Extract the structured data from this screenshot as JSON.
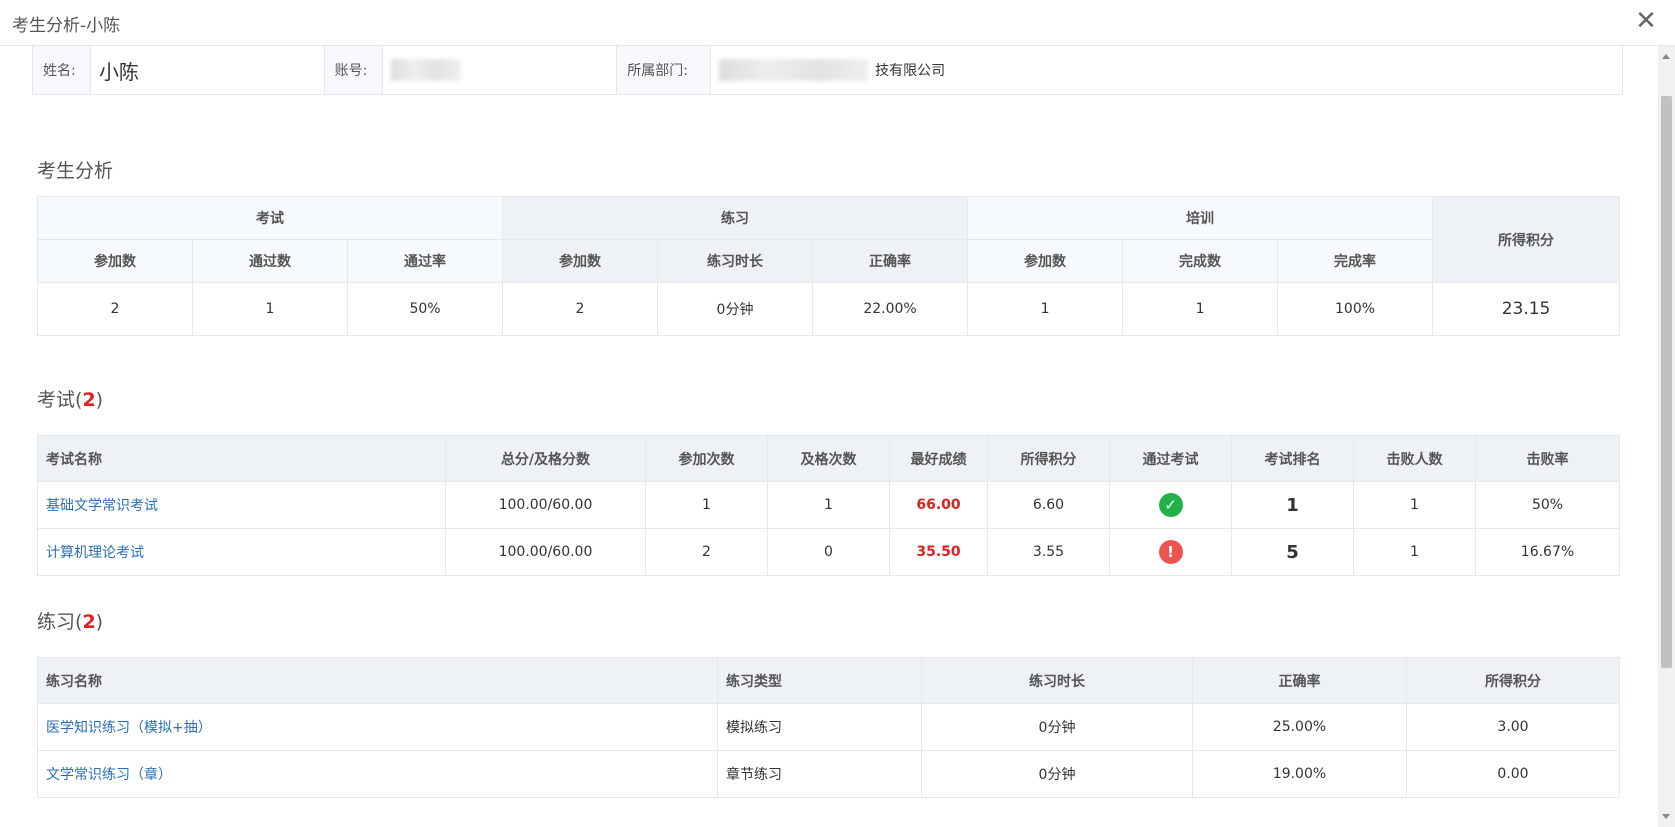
{
  "window": {
    "title": "考生分析-小陈",
    "close_label": "✕"
  },
  "info": {
    "name_label": "姓名:",
    "name_value": "小陈",
    "account_label": "账号:",
    "dept_label": "所属部门:",
    "dept_value": "技有限公司"
  },
  "analysis": {
    "title": "考生分析",
    "groups": {
      "exam": "考试",
      "practice": "练习",
      "training": "培训",
      "points": "所得积分"
    },
    "sub": {
      "exam_join": "参加数",
      "exam_pass": "通过数",
      "exam_rate": "通过率",
      "prac_join": "参加数",
      "prac_time": "练习时长",
      "prac_acc": "正确率",
      "train_join": "参加数",
      "train_done": "完成数",
      "train_rate": "完成率"
    },
    "values": {
      "exam_join": "2",
      "exam_pass": "1",
      "exam_rate": "50%",
      "prac_join": "2",
      "prac_time": "0分钟",
      "prac_acc": "22.00%",
      "train_join": "1",
      "train_done": "1",
      "train_rate": "100%",
      "points": "23.15"
    }
  },
  "exams": {
    "title": "考试",
    "count": "2",
    "headers": [
      "考试名称",
      "总分/及格分数",
      "参加次数",
      "及格次数",
      "最好成绩",
      "所得积分",
      "通过考试",
      "考试排名",
      "击败人数",
      "击败率"
    ],
    "rows": [
      {
        "name": "基础文学常识考试",
        "score": "100.00/60.00",
        "attempts": "1",
        "passes": "1",
        "best": "66.00",
        "points": "6.60",
        "passed": true,
        "rank": "1",
        "defeated": "1",
        "rate": "50%"
      },
      {
        "name": "计算机理论考试",
        "score": "100.00/60.00",
        "attempts": "2",
        "passes": "0",
        "best": "35.50",
        "points": "3.55",
        "passed": false,
        "rank": "5",
        "defeated": "1",
        "rate": "16.67%"
      }
    ]
  },
  "practices": {
    "title": "练习",
    "count": "2",
    "headers": [
      "练习名称",
      "练习类型",
      "练习时长",
      "正确率",
      "所得积分"
    ],
    "rows": [
      {
        "name": "医学知识练习（模拟+抽）",
        "type": "模拟练习",
        "duration": "0分钟",
        "accuracy": "25.00%",
        "points": "3.00"
      },
      {
        "name": "文学常识练习（章）",
        "type": "章节练习",
        "duration": "0分钟",
        "accuracy": "19.00%",
        "points": "0.00"
      }
    ]
  },
  "icons": {
    "pass": "check-circle-icon",
    "fail": "exclamation-circle-icon",
    "close": "close-icon"
  }
}
